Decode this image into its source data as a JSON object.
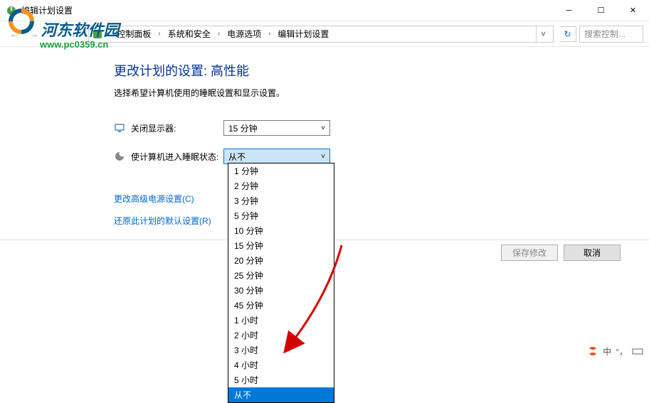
{
  "titlebar": {
    "title": "编辑计划设置"
  },
  "breadcrumb": {
    "items": [
      "控制面板",
      "系统和安全",
      "电源选项",
      "编辑计划设置"
    ]
  },
  "search": {
    "placeholder": "搜索控制..."
  },
  "watermark": {
    "text": "河东软件园",
    "url": "www.pc0359.cn"
  },
  "page": {
    "title": "更改计划的设置: 高性能",
    "subtitle": "选择希望计算机使用的睡眠设置和显示设置。"
  },
  "settings": {
    "display_off_label": "关闭显示器:",
    "display_off_value": "15 分钟",
    "sleep_label": "使计算机进入睡眠状态:",
    "sleep_value": "从不"
  },
  "links": {
    "advanced": "更改高级电源设置(C)",
    "restore": "还原此计划的默认设置(R)"
  },
  "buttons": {
    "save": "保存修改",
    "cancel": "取消"
  },
  "dropdown": {
    "options": [
      "1 分钟",
      "2 分钟",
      "3 分钟",
      "5 分钟",
      "10 分钟",
      "15 分钟",
      "20 分钟",
      "25 分钟",
      "30 分钟",
      "45 分钟",
      "1 小时",
      "2 小时",
      "3 小时",
      "4 小时",
      "5 小时",
      "从不"
    ],
    "selected": "从不"
  },
  "taskbar": {
    "ime": "中"
  }
}
